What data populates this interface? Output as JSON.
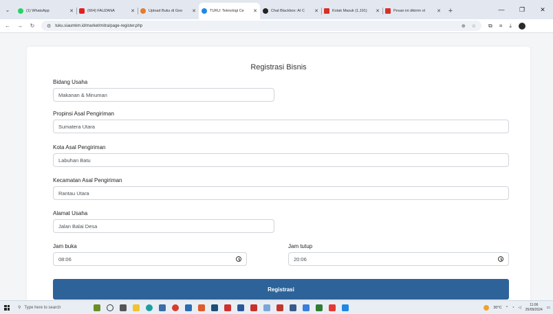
{
  "browser": {
    "tabs": [
      {
        "title": "(1) WhatsApp",
        "color": "#25d366",
        "active": false
      },
      {
        "title": "(664) FAUZANA",
        "color": "#e02020",
        "active": false
      },
      {
        "title": "Upload Buku di Goo",
        "color": "#e87a2a",
        "active": false
      },
      {
        "title": "TUKU: Teknologi Ce",
        "color": "#1e88e5",
        "active": true
      },
      {
        "title": "Chat Blackbox: AI C",
        "color": "#222222",
        "active": false
      },
      {
        "title": "Kotak Masuk (1,191)",
        "color": "#d93025",
        "active": false
      },
      {
        "title": "Pesan ini dikirim ol",
        "color": "#d93025",
        "active": false
      }
    ],
    "url": "tuku.siaumkm.id/market/mitra/page-register.php"
  },
  "form": {
    "title": "Registrasi Bisnis",
    "fields": {
      "bidang": {
        "label": "Bidang Usaha",
        "value": "Makanan & Minuman"
      },
      "propinsi": {
        "label": "Propinsi Asal Pengiriman",
        "value": "Sumatera Utara"
      },
      "kota": {
        "label": "Kota Asal Pengiriman",
        "value": "Labuhan Batu"
      },
      "kecamatan": {
        "label": "Kecamatan Asal Pengiriman",
        "value": "Rantau Utara"
      },
      "alamat": {
        "label": "Alamat Usaha",
        "value": "Jalan Balai Desa"
      },
      "jam_buka": {
        "label": "Jam buka",
        "value": "08:06"
      },
      "jam_tutup": {
        "label": "Jam tutup",
        "value": "20:06"
      }
    },
    "submit_label": "Registrasi",
    "accent": "#2d6399"
  },
  "taskbar": {
    "search_placeholder": "Type here to search",
    "weather": "30°C",
    "time": "11:06",
    "date": "25/09/2024"
  }
}
